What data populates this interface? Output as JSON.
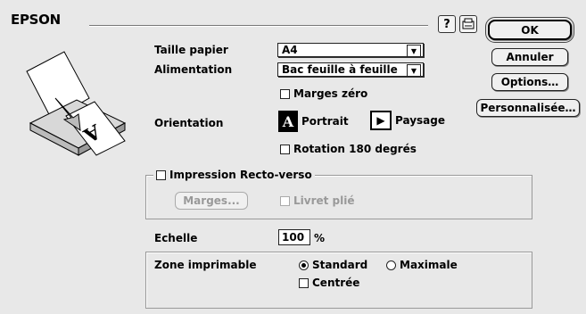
{
  "header": {
    "brand": "EPSON"
  },
  "toolbar": {
    "help_icon_glyph": "?",
    "settings_icon_name": "printer-utility-icon"
  },
  "buttons": {
    "ok": "OK",
    "cancel": "Annuler",
    "options": "Options…",
    "custom": "Personnalisée…"
  },
  "paper": {
    "size_label": "Taille papier",
    "size_value": "A4",
    "source_label": "Alimentation",
    "source_value": "Bac feuille à feuille",
    "zero_margins_label": "Marges zéro",
    "zero_margins_checked": false
  },
  "orientation": {
    "label": "Orientation",
    "portrait_label": "Portrait",
    "landscape_label": "Paysage",
    "selected": "portrait",
    "rotate_label": "Rotation 180 degrés",
    "rotate_checked": false
  },
  "duplex": {
    "label": "Impression Recto-verso",
    "checked": false,
    "margins_button": "Marges...",
    "booklet_label": "Livret plié",
    "booklet_checked": false
  },
  "scale": {
    "label": "Echelle",
    "value": "100",
    "unit": "%"
  },
  "printable_area": {
    "label": "Zone imprimable",
    "standard_label": "Standard",
    "maximum_label": "Maximale",
    "selected": "standard",
    "centered_label": "Centrée",
    "centered_checked": false
  }
}
